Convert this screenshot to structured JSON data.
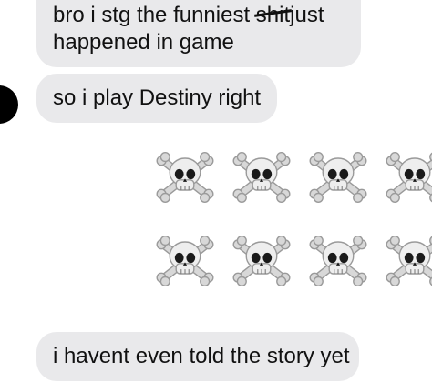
{
  "messages": [
    {
      "line1_prefix": "bro i stg the funniest ",
      "line1_struck": "shit",
      "line1_suffix": "just",
      "line2": "happened in game"
    },
    {
      "text": "so i play Destiny right"
    },
    {
      "emoji_name": "skull-and-crossbones-icon",
      "emoji_char": "☠️",
      "count_visible": 8
    },
    {
      "text": "i havent even told the story yet"
    }
  ],
  "colors": {
    "bubble_bg": "#e9e9eb",
    "text": "#111111",
    "background": "#ffffff",
    "avatar": "#000000"
  }
}
